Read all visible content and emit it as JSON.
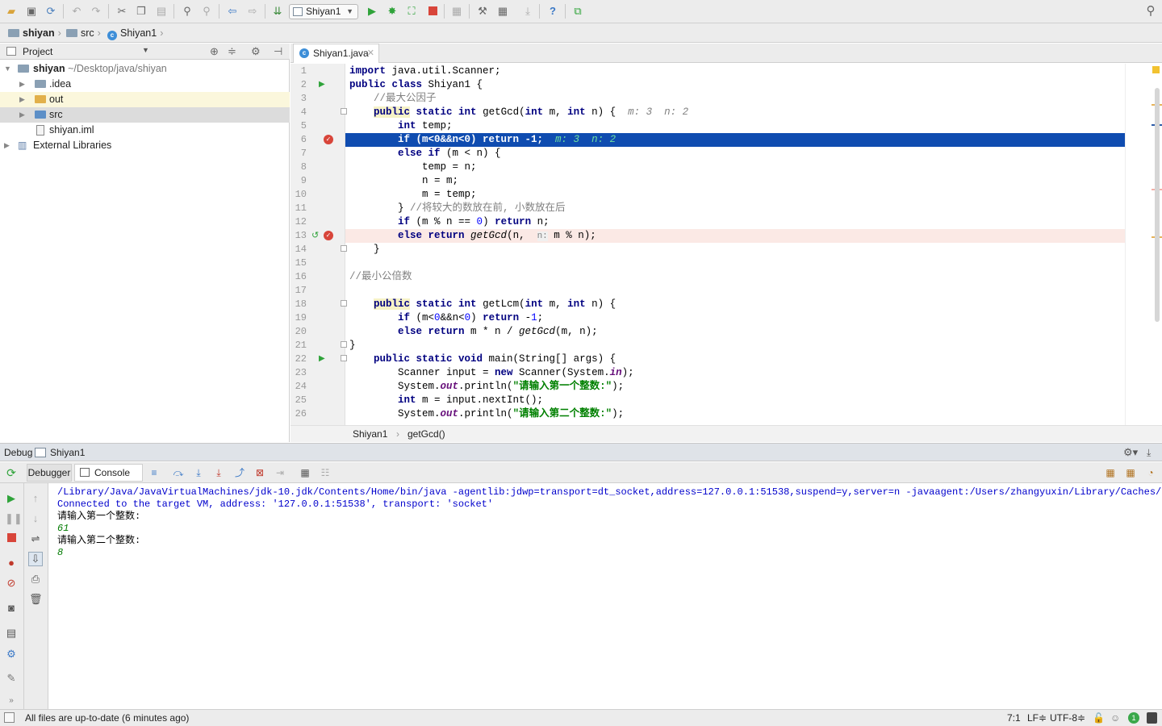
{
  "breadcrumb": {
    "project": "shiyan",
    "folder": "src",
    "file": "Shiyan1"
  },
  "run_config": {
    "label": "Shiyan1"
  },
  "project_panel": {
    "header": "Project",
    "root_name": "shiyan",
    "root_path": "~/Desktop/java/shiyan",
    "items": [
      {
        "label": ".idea"
      },
      {
        "label": "out"
      },
      {
        "label": "src"
      },
      {
        "label": "shiyan.iml"
      },
      {
        "label": "External Libraries"
      }
    ]
  },
  "editor": {
    "tab_label": "Shiyan1.java",
    "line_numbers": [
      "1",
      "2",
      "3",
      "4",
      "5",
      "6",
      "7",
      "8",
      "9",
      "10",
      "11",
      "12",
      "13",
      "14",
      "15",
      "16",
      "17",
      "18",
      "19",
      "20",
      "21",
      "22",
      "23",
      "24",
      "25",
      "26"
    ],
    "inline": {
      "m4": "m: 3",
      "n4": "n: 2",
      "m6": "m: 3",
      "n6": "n: 2",
      "hint13": "n:"
    },
    "breadcrumb_class": "Shiyan1",
    "breadcrumb_method": "getGcd()"
  },
  "debug": {
    "title": "Debug",
    "config": "Shiyan1",
    "tab_debugger": "Debugger",
    "tab_console": "Console"
  },
  "console": {
    "lines": [
      "/Library/Java/JavaVirtualMachines/jdk-10.jdk/Contents/Home/bin/java -agentlib:jdwp=transport=dt_socket,address=127.0.0.1:51538,suspend=y,server=n -javaagent:/Users/zhangyuxin/Library/Caches/Intel",
      "Connected to the target VM, address: '127.0.0.1:51538', transport: 'socket'",
      "请输入第一个整数:",
      "61",
      "请输入第二个整数:",
      "8"
    ]
  },
  "status": {
    "message": "All files are up-to-date (6 minutes ago)",
    "position": "7:1",
    "line_sep": "LF≑",
    "encoding": "UTF-8≑",
    "badge": "1"
  },
  "colors": {
    "selection": "#0f4cb0",
    "breakpoint": "#d8453a",
    "bp_line": "#fbe9e5"
  }
}
